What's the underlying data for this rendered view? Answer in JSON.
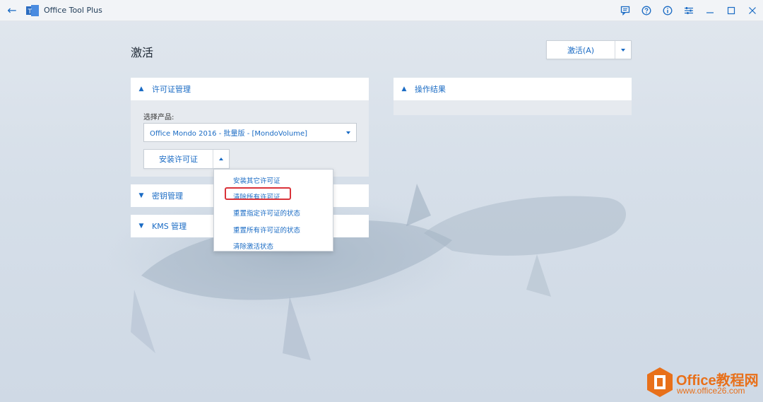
{
  "titlebar": {
    "app_title": "Office Tool Plus",
    "icons": [
      "back-arrow-icon",
      "app-logo-icon",
      "feedback-icon",
      "help-icon",
      "info-icon",
      "settings-sliders-icon",
      "minimize-icon",
      "maximize-icon",
      "close-icon"
    ],
    "back_glyph": "←",
    "logo_letter": "T"
  },
  "page": {
    "title": "激活",
    "activate_button": "激活(A)"
  },
  "license_panel": {
    "header": "许可证管理",
    "select_product_label": "选择产品:",
    "selected_product": "Office Mondo 2016 - 批量版 - [MondoVolume]",
    "install_button": "安装许可证",
    "menu_items": [
      "安装其它许可证",
      "清除所有许可证",
      "重置指定许可证的状态",
      "重置所有许可证的状态",
      "清除激活状态"
    ],
    "highlighted_item": "清除所有许可证"
  },
  "key_panel": {
    "header": "密钥管理"
  },
  "kms_panel": {
    "header": "KMS 管理"
  },
  "result_panel": {
    "header": "操作结果"
  },
  "watermark": {
    "name": "Office教程网",
    "url": "www.office26.com"
  },
  "colors": {
    "accent": "#1a6bc4",
    "highlight_border": "#d9333a",
    "watermark": "#e8701a"
  }
}
